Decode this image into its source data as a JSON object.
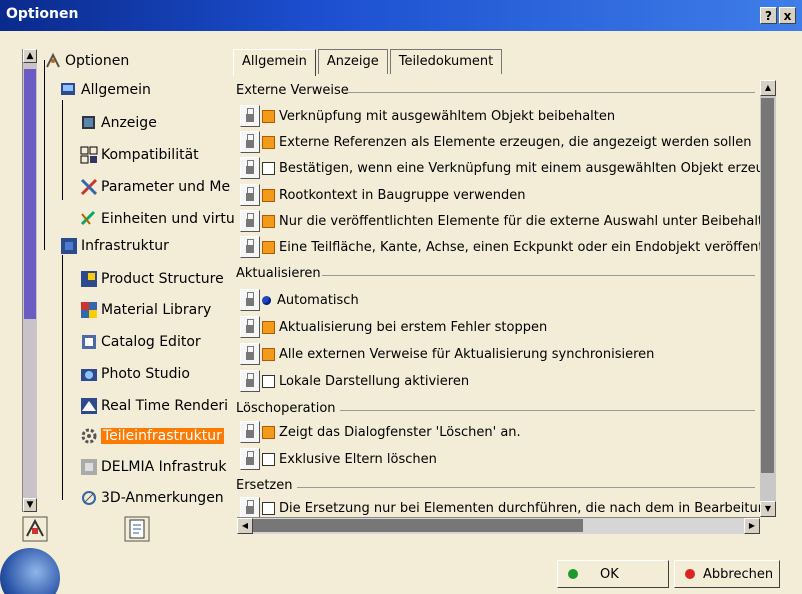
{
  "window": {
    "title": "Optionen",
    "help_btn": "?",
    "close_btn": "x"
  },
  "tree": {
    "root": "Optionen",
    "allgemein": "Allgemein",
    "allgemein_children": [
      "Anzeige",
      "Kompatibilität",
      "Parameter und Me",
      "Einheiten und virtu"
    ],
    "infrastruktur": "Infrastruktur",
    "infra_children": [
      "Product Structure",
      "Material Library",
      "Catalog Editor",
      "Photo Studio",
      "Real Time Renderi",
      "Teileinfrastruktur",
      "DELMIA Infrastruk",
      "3D-Anmerkungen"
    ]
  },
  "tabs": [
    "Allgemein",
    "Anzeige",
    "Teiledokument"
  ],
  "groups": {
    "externe": "Externe Verweise",
    "aktualisieren": "Aktualisieren",
    "loesch": "Löschoperation",
    "ersetzen": "Ersetzen"
  },
  "externe_items": [
    "Verknüpfung mit ausgewähltem Objekt beibehalten",
    "Externe Referenzen als Elemente erzeugen, die angezeigt werden sollen",
    "Bestätigen, wenn eine Verknüpfung mit einem ausgewählten Objekt erzeug",
    "Rootkontext in Baugruppe verwenden",
    "Nur die veröffentlichten Elemente für die externe Auswahl unter Beibehaltu",
    "Eine Teilfläche, Kante, Achse, einen Eckpunkt oder ein Endobjekt veröffentl"
  ],
  "aktual_items": [
    "Automatisch",
    "Aktualisierung bei erstem Fehler stoppen",
    "Alle externen Verweise für Aktualisierung synchronisieren",
    "Lokale Darstellung aktivieren"
  ],
  "loesch_items": [
    "Zeigt das Dialogfenster 'Löschen' an.",
    "Exklusive Eltern löschen"
  ],
  "ersetzen_items": [
    "Die Ersetzung nur bei Elementen durchführen, die nach dem in Bearbeitung"
  ],
  "buttons": {
    "ok": "OK",
    "cancel": "Abbrechen"
  }
}
